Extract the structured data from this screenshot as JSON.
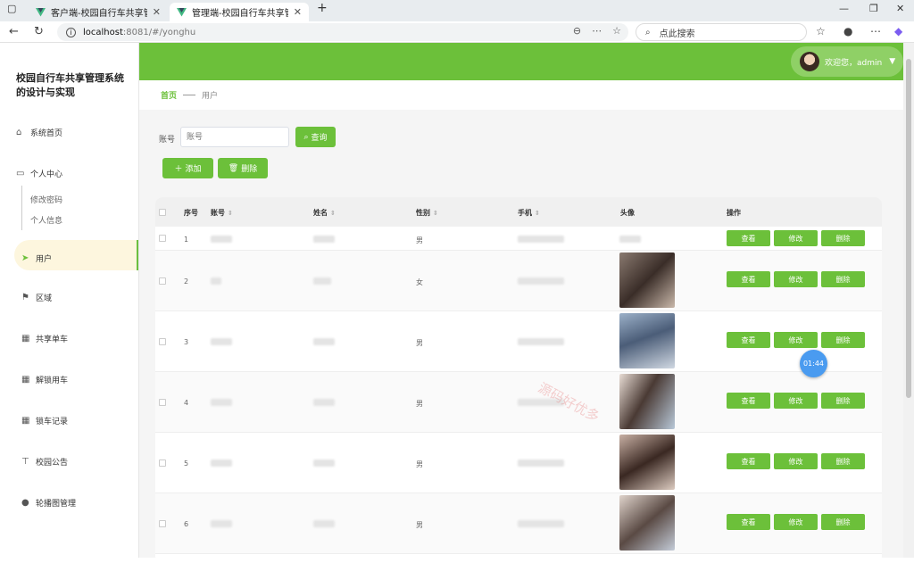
{
  "browser": {
    "tabs": [
      {
        "title": "客户端-校园自行车共享管理系统的设计与实现"
      },
      {
        "title": "管理端-校园自行车共享管理系统的设计与实现"
      }
    ],
    "url_host": "localhost",
    "url_path": ":8081/#/yonghu",
    "search_placeholder": "点此搜索"
  },
  "app": {
    "system_title": "校园自行车共享管理系统的设计与实现",
    "welcome": "欢迎您，admin",
    "menu": [
      {
        "label": "系统首页",
        "icon": "home-icon"
      },
      {
        "label": "个人中心",
        "icon": "person-card-icon"
      },
      {
        "label": "用户",
        "icon": "send-icon",
        "active": true
      },
      {
        "label": "区域",
        "icon": "flag-icon"
      },
      {
        "label": "共享单车",
        "icon": "grid-icon"
      },
      {
        "label": "解锁用车",
        "icon": "grid-icon"
      },
      {
        "label": "锁车记录",
        "icon": "grid-icon"
      },
      {
        "label": "校园公告",
        "icon": "sign-icon"
      },
      {
        "label": "轮播图管理",
        "icon": "pin-icon"
      }
    ],
    "submenu": [
      "修改密码",
      "个人信息"
    ],
    "breadcrumb": {
      "home": "首页",
      "current": "用户"
    },
    "filter": {
      "label": "账号",
      "placeholder": "账号",
      "query_button": "查询"
    },
    "actions": {
      "add": "添加",
      "delete": "删除"
    },
    "table": {
      "headers": [
        "序号",
        "账号",
        "姓名",
        "性别",
        "手机",
        "头像",
        "操作"
      ],
      "rows": [
        {
          "index": "1",
          "gender": "男"
        },
        {
          "index": "2",
          "gender": "女"
        },
        {
          "index": "3",
          "gender": "男"
        },
        {
          "index": "4",
          "gender": "男"
        },
        {
          "index": "5",
          "gender": "男"
        },
        {
          "index": "6",
          "gender": "男"
        }
      ],
      "row_actions": {
        "view": "查看",
        "edit": "修改",
        "delete": "删除"
      }
    },
    "timer": "01:44",
    "watermark": "源码好优多",
    "colors": {
      "accent": "#6cc03a",
      "timer": "#4a9bf0"
    }
  }
}
